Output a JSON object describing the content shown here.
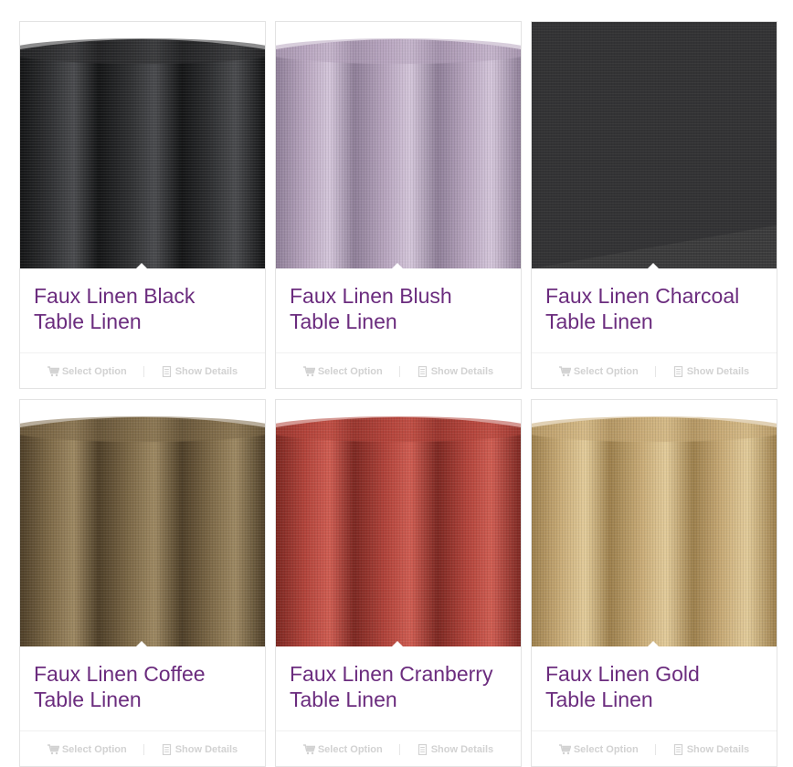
{
  "products": [
    {
      "title_line1": "Faux Linen Black",
      "title_line2": "Table Linen",
      "select_label": "Select Option",
      "details_label": "Show Details",
      "fabric_color": "#2f3032",
      "fabric_shadow": "#141516",
      "fabric_highlight": "#4a4b4e"
    },
    {
      "title_line1": "Faux Linen Blush",
      "title_line2": "Table Linen",
      "select_label": "Select Option",
      "details_label": "Show Details",
      "fabric_color": "#b8a6bf",
      "fabric_shadow": "#8f7f98",
      "fabric_highlight": "#d4c6da"
    },
    {
      "title_line1": "Faux Linen Charcoal",
      "title_line2": "Table Linen",
      "select_label": "Select Option",
      "details_label": "Show Details",
      "fabric_color": "#3b3b3c",
      "fabric_shadow": "#262627",
      "fabric_highlight": "#4a4a4b"
    },
    {
      "title_line1": "Faux Linen Coffee",
      "title_line2": "Table Linen",
      "select_label": "Select Option",
      "details_label": "Show Details",
      "fabric_color": "#7e6a48",
      "fabric_shadow": "#4e3f28",
      "fabric_highlight": "#9d8862"
    },
    {
      "title_line1": "Faux Linen Cranberry",
      "title_line2": "Table Linen",
      "select_label": "Select Option",
      "details_label": "Show Details",
      "fabric_color": "#b2443b",
      "fabric_shadow": "#7d2822",
      "fabric_highlight": "#cf5d52"
    },
    {
      "title_line1": "Faux Linen Gold",
      "title_line2": "Table Linen",
      "select_label": "Select Option",
      "details_label": "Show Details",
      "fabric_color": "#c9ac78",
      "fabric_shadow": "#9d804d",
      "fabric_highlight": "#e2cb9a"
    }
  ],
  "colors": {
    "title": "#6b2c7e",
    "action_text": "#d2d2d2",
    "card_border": "#e3e3e3"
  },
  "icons": {
    "select": "shopping-cart-icon",
    "details": "document-icon"
  }
}
